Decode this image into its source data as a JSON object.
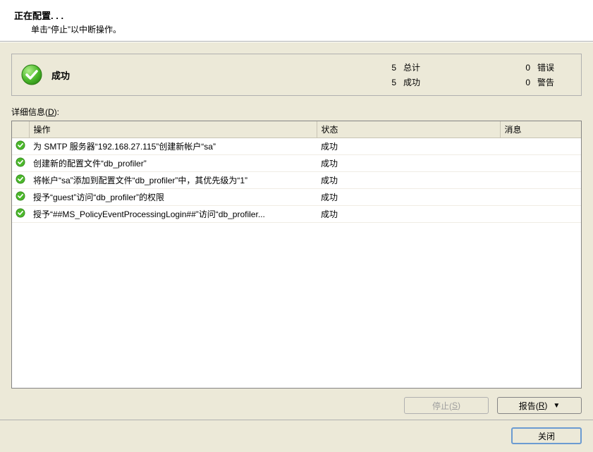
{
  "header": {
    "title": "正在配置. . .",
    "subtitle": "单击“停止”以中断操作。"
  },
  "status": {
    "label": "成功",
    "totalCount": "5",
    "totalLabel": "总计",
    "successCount": "5",
    "successLabel": "成功",
    "errorCount": "0",
    "errorLabel": "错误",
    "warningCount": "0",
    "warningLabel": "警告"
  },
  "details": {
    "labelPrefix": "详细信息(",
    "labelKey": "D",
    "labelSuffix": "):",
    "columns": {
      "action": "操作",
      "status": "状态",
      "message": "消息"
    },
    "rows": [
      {
        "action": "为 SMTP 服务器“192.168.27.115”创建新帐户“sa”",
        "status": "成功",
        "message": ""
      },
      {
        "action": "创建新的配置文件“db_profiler”",
        "status": "成功",
        "message": ""
      },
      {
        "action": "将帐户“sa”添加到配置文件“db_profiler”中，其优先级为“1”",
        "status": "成功",
        "message": ""
      },
      {
        "action": "授予“guest”访问“db_profiler”的权限",
        "status": "成功",
        "message": ""
      },
      {
        "action": "授予“##MS_PolicyEventProcessingLogin##”访问“db_profiler...",
        "status": "成功",
        "message": ""
      }
    ]
  },
  "buttons": {
    "stopPrefix": "停止(",
    "stopKey": "S",
    "stopSuffix": ")",
    "reportPrefix": "报告(",
    "reportKey": "R",
    "reportSuffix": ")",
    "close": "关闭"
  }
}
